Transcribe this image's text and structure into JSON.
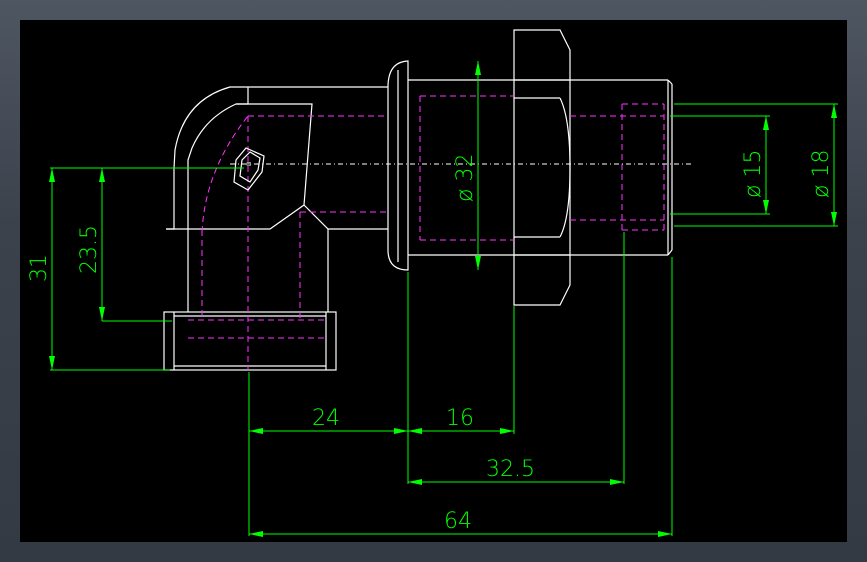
{
  "drawing": {
    "colors": {
      "background": "#000000",
      "frame": "#3d444e",
      "outline": "#ffffff",
      "hidden_lines": "#ff33ff",
      "dimensions": "#00ff00"
    },
    "dimensions": {
      "overall_height": "31",
      "center_height": "23.5",
      "elbow_offset": "24",
      "nut_length": "16",
      "bore_length": "32.5",
      "overall_length": "64",
      "nut_diameter": "ø 32",
      "inner_diameter": "ø 15",
      "outer_diameter": "ø 18"
    },
    "logo_icon": "mark-icon"
  }
}
